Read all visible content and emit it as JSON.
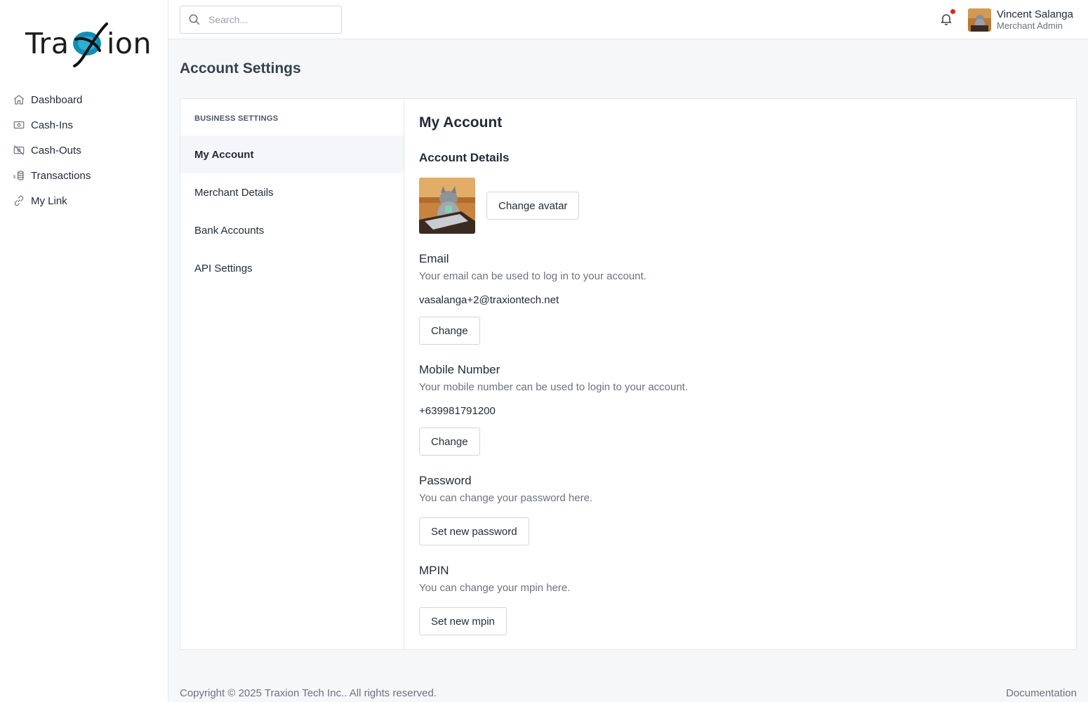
{
  "app": {
    "logo_prefix": "Tra",
    "logo_suffix": "ion"
  },
  "sidebar": {
    "items": [
      {
        "label": "Dashboard",
        "icon": "home-icon"
      },
      {
        "label": "Cash-Ins",
        "icon": "cash-icon"
      },
      {
        "label": "Cash-Outs",
        "icon": "cash-off-icon"
      },
      {
        "label": "Transactions",
        "icon": "coins-icon"
      },
      {
        "label": "My Link",
        "icon": "link-icon"
      }
    ]
  },
  "topbar": {
    "search_placeholder": "Search...",
    "user_name": "Vincent Salanga",
    "user_role": "Merchant Admin",
    "notification_dot_color": "#e02424"
  },
  "page": {
    "title": "Account Settings"
  },
  "settings_nav": {
    "section_label": "BUSINESS SETTINGS",
    "items": [
      {
        "label": "My Account",
        "active": true
      },
      {
        "label": "Merchant Details",
        "active": false
      },
      {
        "label": "Bank Accounts",
        "active": false
      },
      {
        "label": "API Settings",
        "active": false
      }
    ]
  },
  "account": {
    "title": "My Account",
    "details_title": "Account Details",
    "change_avatar_label": "Change avatar",
    "email": {
      "title": "Email",
      "description": "Your email can be used to log in to your account.",
      "value": "vasalanga+2@traxiontech.net",
      "button": "Change"
    },
    "mobile": {
      "title": "Mobile Number",
      "description": "Your mobile number can be used to login to your account.",
      "value": "+639981791200",
      "button": "Change"
    },
    "password": {
      "title": "Password",
      "description": "You can change your password here.",
      "button": "Set new password"
    },
    "mpin": {
      "title": "MPIN",
      "description": "You can change your mpin here.",
      "button": "Set new mpin"
    }
  },
  "footer": {
    "copyright": "Copyright © 2025 Traxion Tech Inc.. All rights reserved.",
    "documentation": "Documentation"
  }
}
